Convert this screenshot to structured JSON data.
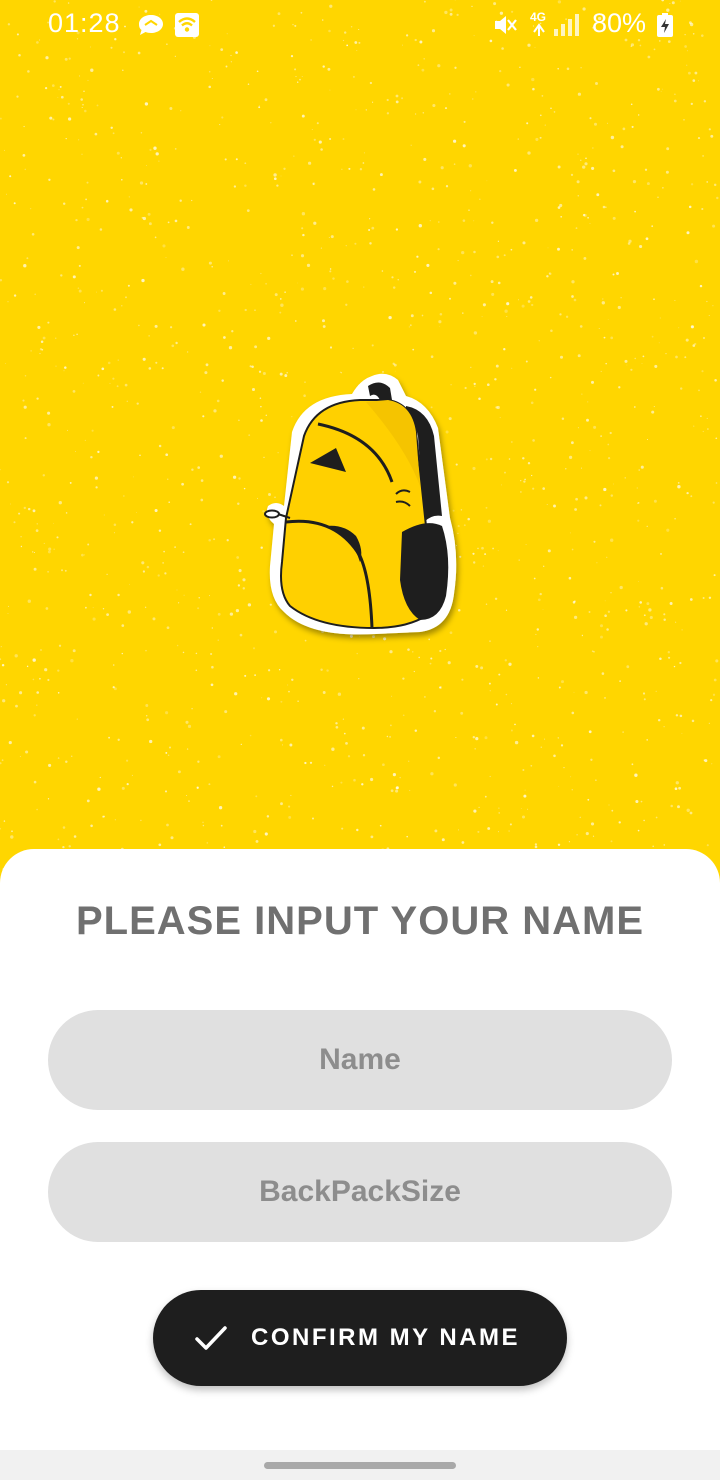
{
  "status_bar": {
    "time": "01:28",
    "network": "4G",
    "battery": "80%",
    "icons": [
      "message-icon",
      "wifi-icon",
      "mute-icon",
      "signal-icon",
      "battery-charging-icon"
    ]
  },
  "hero": {
    "illustration": "backpack-illustration",
    "background_color": "#FFD600"
  },
  "form": {
    "title": "PLEASE INPUT YOUR NAME",
    "name_placeholder": "Name",
    "name_value": "",
    "size_placeholder": "BackPackSize",
    "size_value": "",
    "confirm_label": "CONFIRM MY NAME",
    "confirm_icon": "check-icon"
  },
  "colors": {
    "accent": "#FFD600",
    "field_bg": "#E0E0E0",
    "button_bg": "#1E1E1E",
    "title_text": "#707070"
  }
}
